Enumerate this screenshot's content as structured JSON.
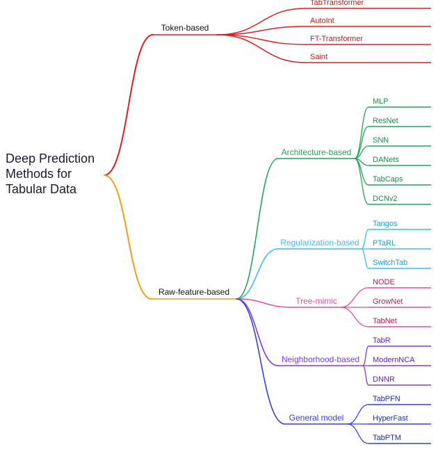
{
  "root": {
    "title_line1": "Deep Prediction",
    "title_line2": "Methods for",
    "title_line3": "Tabular Data"
  },
  "branches": {
    "token": {
      "label": "Token-based",
      "color": "#e11d1d",
      "leaves": [
        "TabTransformer",
        "AutoInt",
        "FT-Transformer",
        "Saint"
      ],
      "leaf_color": "#b91c1c"
    },
    "raw": {
      "label": "Raw-feature-based",
      "color": "#f59e0b",
      "groups": {
        "arch": {
          "label": "Architecture-based",
          "color": "#22a559",
          "leaves": [
            "MLP",
            "ResNet",
            "SNN",
            "DANets",
            "TabCaps",
            "DCNv2"
          ],
          "leaf_color": "#1e8b4a"
        },
        "reg": {
          "label": "Regularization-based",
          "color": "#38bdf8",
          "leaves": [
            "Tangos",
            "PTaRL",
            "SwitchTab"
          ],
          "leaf_color": "#0ea5d4"
        },
        "tree": {
          "label": "Tree-mimic",
          "color": "#ec4899",
          "leaves": [
            "NODE",
            "GrowNet",
            "TabNet"
          ],
          "leaf_color": "#be185d"
        },
        "nbh": {
          "label": "Neighborhood-based",
          "color": "#7c3aed",
          "leaves": [
            "TabR",
            "ModernNCA",
            "DNNR"
          ],
          "leaf_color": "#5b21b6"
        },
        "gen": {
          "label": "General model",
          "color": "#2f3ee8",
          "leaves": [
            "TabPFN",
            "HyperFast",
            "TabPTM"
          ],
          "leaf_color": "#1e2bbd"
        }
      }
    }
  }
}
